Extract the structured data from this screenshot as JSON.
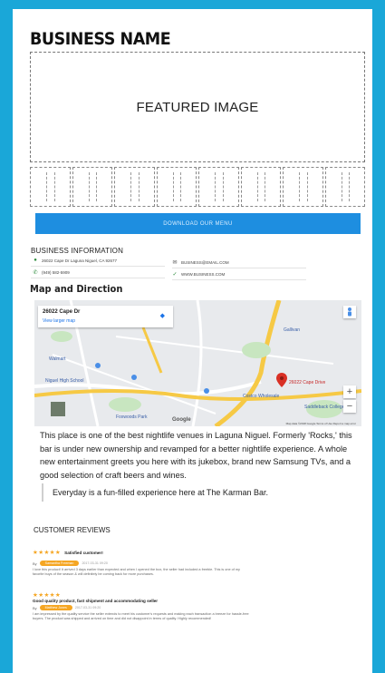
{
  "business_name": "BUSINESS NAME",
  "featured_image_label": "FEATURED IMAGE",
  "thumbnail_count": 8,
  "menu_button_label": "DOWNLOAD OUR MENU",
  "info": {
    "title": "BUSINESS INFORMATION",
    "address": "26022 Cape Dr Laguna Niguel, CA 92677",
    "phone": "(949) 582-5909",
    "email": "BUSINESS@EMAIL.COM",
    "website": "WWW.BUSINESS.COM"
  },
  "map": {
    "title": "Map and Direction",
    "card_address": "26022 Cape Dr",
    "view_larger": "View larger map",
    "pin_label": "26022 Cape Drive",
    "labels": [
      "Gallivan",
      "Costco Wholesale",
      "Saddleback College",
      "Niguel High School",
      "Walmart",
      "Foxwoods Park"
    ],
    "zoom_in": "+",
    "zoom_out": "−",
    "google": "Google",
    "footer": "Map data ©2018 Google   Terms of Use   Report a map error"
  },
  "description": "This place is one of the best nightlife venues in Laguna Niguel. Formerly 'Rocks,' this bar is under new ownership and revamped for a better nightlife experience. A whole new entertainment greets you here with its jukebox, brand new Samsung TVs, and a good selection of craft beers and wines.",
  "quote": "Everyday is a fun-filled experience here at The Karman Bar.",
  "reviews": {
    "title": "CUSTOMER REVIEWS",
    "items": [
      {
        "stars": "★★★★★",
        "title": "Satisfied customer!",
        "by": "By",
        "author": "Samantha Freeman",
        "date": "2017-03-31 09:20",
        "body": "I love this product! It arrived 3 days earlier than expected and when I opened the box, the seller had included a freebie. This is one of my favorite buys of the season & will definitely be coming back for more purchases."
      },
      {
        "stars": "★★★★★",
        "title": "Good quality product, fast shipment and accommodating seller",
        "by": "By",
        "author": "Matthew Jones",
        "date": "2017-03-31 09:20",
        "body": "I am impressed by the quality service the seller extends to meet his customer's requests and making each transaction a breeze for hassle-free buyers. The product was shipped and arrived on time and did not disappoint in terms of quality. Highly recommended!"
      }
    ]
  },
  "colors": {
    "frame": "#1aa7d8",
    "button": "#1e8ee0",
    "star": "#f5a623",
    "pin": "#d93025"
  }
}
